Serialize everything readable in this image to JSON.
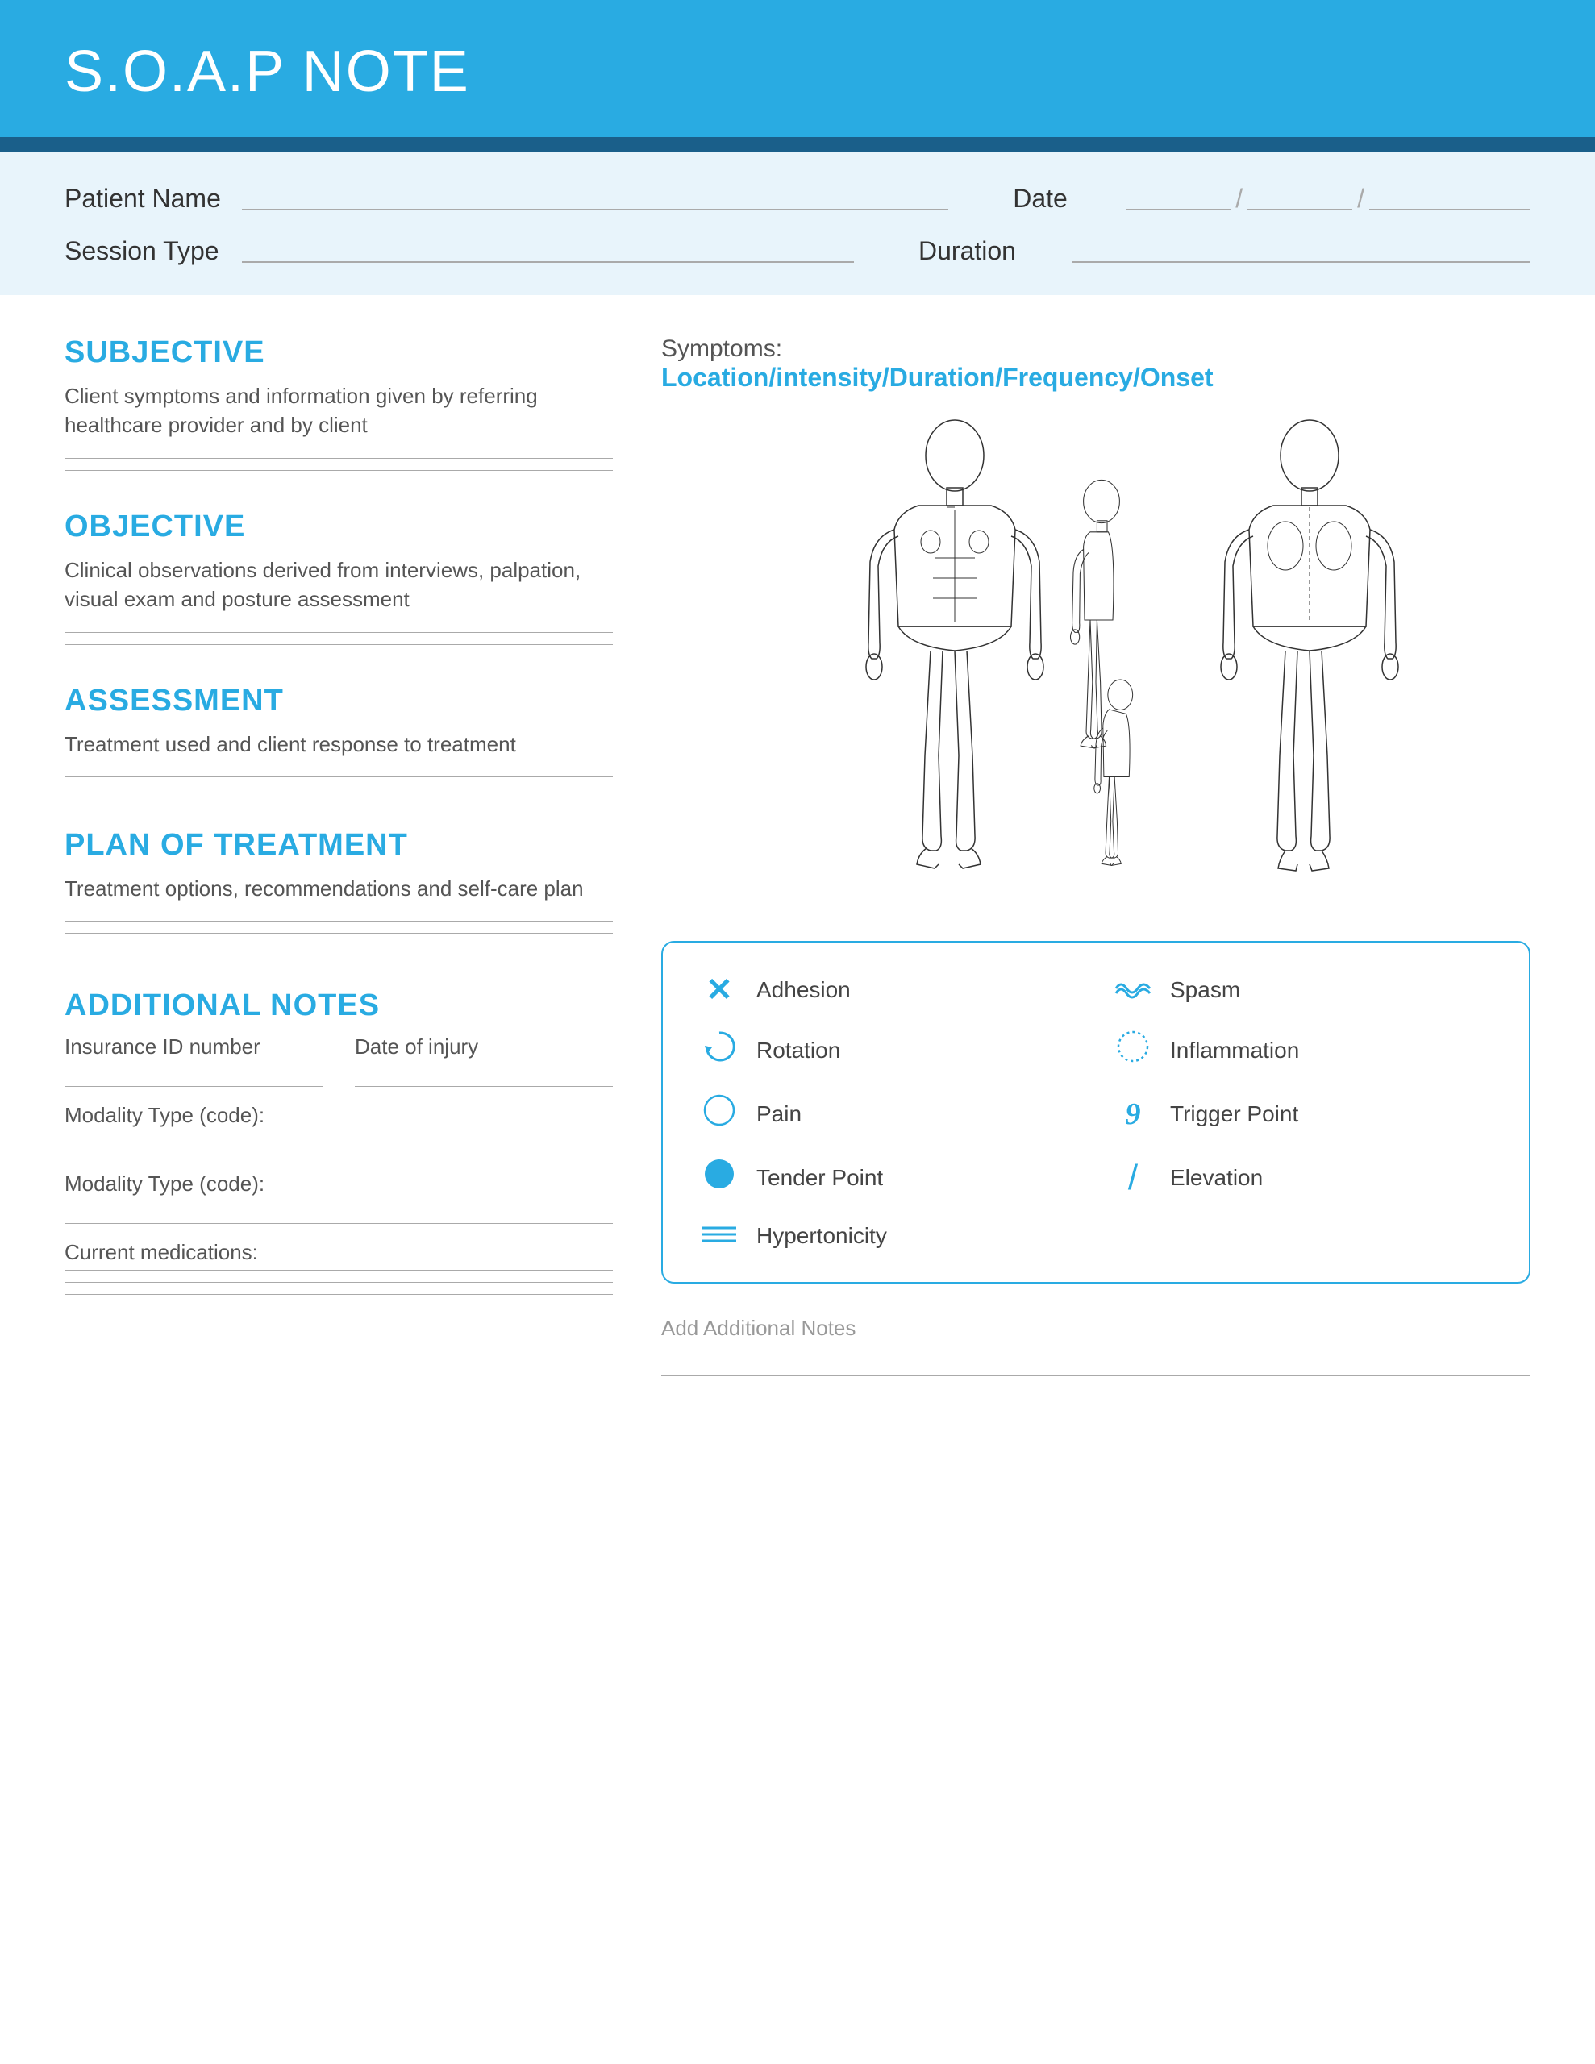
{
  "header": {
    "title": "S.O.A.P NOTE"
  },
  "patientInfo": {
    "patientNameLabel": "Patient Name",
    "dateLabel": "Date",
    "sessionTypeLabel": "Session Type",
    "durationLabel": "Duration"
  },
  "sections": {
    "subjective": {
      "heading": "SUBJECTIVE",
      "description": "Client symptoms and information given by referring healthcare provider and by client"
    },
    "objective": {
      "heading": "OBJECTIVE",
      "description": "Clinical observations derived from interviews, palpation, visual exam and posture assessment"
    },
    "assessment": {
      "heading": "ASSESSMENT",
      "description": "Treatment used and client response to treatment"
    },
    "planOfTreatment": {
      "heading": "PLAN OF TREATMENT",
      "description": "Treatment options, recommendations and self-care plan"
    },
    "additionalNotes": {
      "heading": "ADDITIONAL NOTES",
      "insuranceIdLabel": "Insurance ID number",
      "dateOfInjuryLabel": "Date of injury",
      "modalityLabel1": "Modality Type (code):",
      "modalityLabel2": "Modality Type (code):",
      "currentMedsLabel": "Current medications:"
    }
  },
  "symptoms": {
    "label": "Symptoms:",
    "subtitle": "Location/intensity/Duration/Frequency/Onset"
  },
  "legend": {
    "items": [
      {
        "icon": "✕",
        "label": "Adhesion"
      },
      {
        "icon": "≈",
        "label": "Spasm"
      },
      {
        "icon": "↺",
        "label": "Rotation"
      },
      {
        "icon": "○",
        "label": "Inflammation"
      },
      {
        "icon": "○",
        "label": "Pain"
      },
      {
        "icon": "9",
        "label": "Trigger Point"
      },
      {
        "icon": "●",
        "label": "Tender Point"
      },
      {
        "icon": "/",
        "label": "Elevation"
      },
      {
        "icon": "≡",
        "label": "Hypertonicity"
      }
    ]
  },
  "additionalNotesRight": {
    "label": "Add Additional Notes"
  }
}
